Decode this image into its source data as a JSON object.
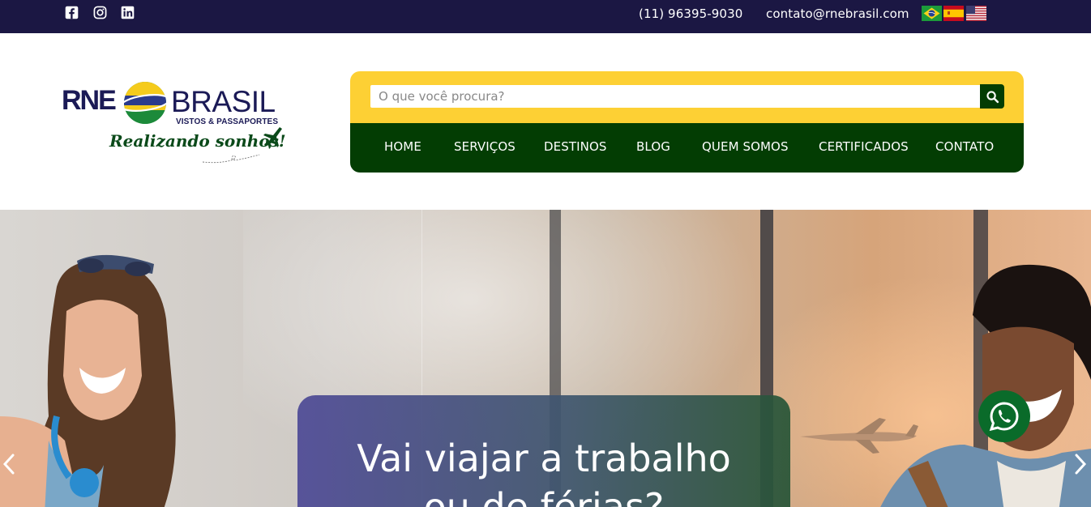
{
  "topbar": {
    "phone": "(11) 96395-9030",
    "email": "contato@rnebrasil.com",
    "social_icons": [
      "facebook-icon",
      "instagram-icon",
      "linkedin-icon"
    ],
    "languages": [
      "pt-BR",
      "es",
      "en-US"
    ]
  },
  "logo": {
    "rne": "RNE",
    "brasil": "BRASIL",
    "subtitle": "VISTOS & PASSAPORTES",
    "slogan": "Realizando sonhos!"
  },
  "search": {
    "placeholder": "O que você procura?",
    "value": ""
  },
  "nav": {
    "items": [
      {
        "label": "HOME"
      },
      {
        "label": "SERVIÇOS"
      },
      {
        "label": "DESTINOS"
      },
      {
        "label": "BLOG"
      },
      {
        "label": "QUEM SOMOS"
      },
      {
        "label": "CERTIFICADOS"
      },
      {
        "label": "CONTATO"
      }
    ]
  },
  "hero": {
    "title_line1": "Vai viajar a trabalho",
    "title_line2": "ou de férias?"
  },
  "colors": {
    "topbar": "#1b1743",
    "yellow": "#fdd034",
    "green": "#033d03",
    "whatsapp": "#0a6b2a"
  }
}
